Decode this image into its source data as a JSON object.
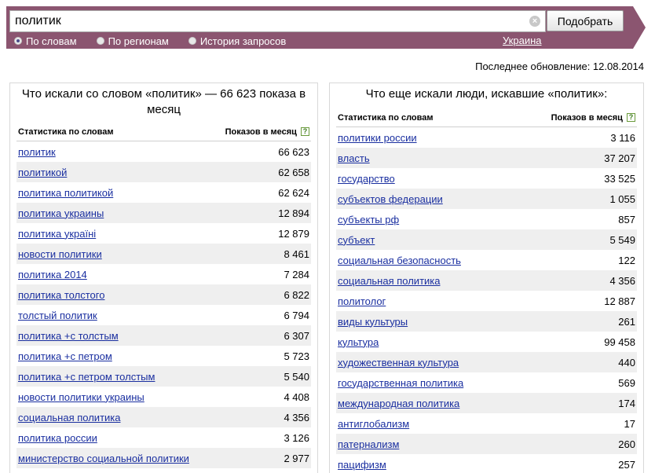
{
  "search": {
    "value": "политик",
    "clear_symbol": "×",
    "submit_label": "Подобрать"
  },
  "modes": [
    {
      "label": "По словам",
      "checked": true
    },
    {
      "label": "По регионам",
      "checked": false
    },
    {
      "label": "История запросов",
      "checked": false
    }
  ],
  "region": "Украина",
  "last_update": "Последнее обновление: 12.08.2014",
  "left_panel": {
    "title": "Что искали со словом «политик» — 66 623 показа в месяц",
    "col_words": "Статистика по словам",
    "col_count": "Показов в месяц",
    "help": "?",
    "rows": [
      {
        "phrase": "политик",
        "count": "66 623"
      },
      {
        "phrase": "политикой",
        "count": "62 658"
      },
      {
        "phrase": "политика политикой",
        "count": "62 624"
      },
      {
        "phrase": "политика украины",
        "count": "12 894"
      },
      {
        "phrase": "политика україні",
        "count": "12 879"
      },
      {
        "phrase": "новости политики",
        "count": "8 461"
      },
      {
        "phrase": "политика 2014",
        "count": "7 284"
      },
      {
        "phrase": "политика толстого",
        "count": "6 822"
      },
      {
        "phrase": "толстый политик",
        "count": "6 794"
      },
      {
        "phrase": "политика +с толстым",
        "count": "6 307"
      },
      {
        "phrase": "политика +с петром",
        "count": "5 723"
      },
      {
        "phrase": "политика +с петром толстым",
        "count": "5 540"
      },
      {
        "phrase": "новости политики украины",
        "count": "4 408"
      },
      {
        "phrase": "социальная политика",
        "count": "4 356"
      },
      {
        "phrase": "политика россии",
        "count": "3 126"
      },
      {
        "phrase": "министерство социальной политики",
        "count": "2 977"
      }
    ]
  },
  "right_panel": {
    "title": "Что еще искали люди, искавшие «политик»:",
    "col_words": "Статистика по словам",
    "col_count": "Показов в месяц",
    "help": "?",
    "rows": [
      {
        "phrase": "политики россии",
        "count": "3 116"
      },
      {
        "phrase": "власть",
        "count": "37 207"
      },
      {
        "phrase": "государство",
        "count": "33 525"
      },
      {
        "phrase": "субъектов федерации",
        "count": "1 055"
      },
      {
        "phrase": "субъекты рф",
        "count": "857"
      },
      {
        "phrase": "субъект",
        "count": "5 549"
      },
      {
        "phrase": "социальная безопасность",
        "count": "122"
      },
      {
        "phrase": "социальная политика",
        "count": "4 356"
      },
      {
        "phrase": "политолог",
        "count": "12 887"
      },
      {
        "phrase": "виды культуры",
        "count": "261"
      },
      {
        "phrase": "культура",
        "count": "99 458"
      },
      {
        "phrase": "художественная культура",
        "count": "440"
      },
      {
        "phrase": "государственная политика",
        "count": "569"
      },
      {
        "phrase": "международная политика",
        "count": "174"
      },
      {
        "phrase": "антиглобализм",
        "count": "17"
      },
      {
        "phrase": "патернализм",
        "count": "260"
      },
      {
        "phrase": "пацифизм",
        "count": "257"
      }
    ]
  },
  "colors": {
    "bar": "#8b5570",
    "link": "#1a2fa0",
    "row_alt": "#efefef"
  }
}
